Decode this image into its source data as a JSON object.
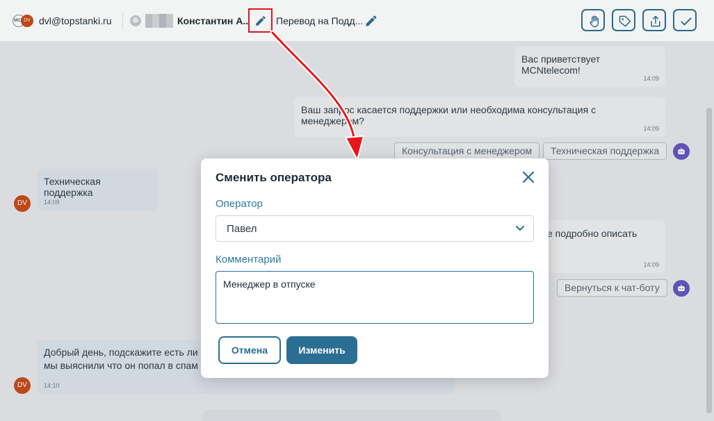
{
  "header": {
    "email": "dvl@topstanki.ru",
    "logo_left": "MCN",
    "logo_right": "DV",
    "client_name": "Константин А...",
    "transfer_label": "Перевод на Подд...",
    "icons": [
      "hand-icon",
      "tag-icon",
      "export-icon",
      "check-icon"
    ]
  },
  "chat": {
    "messages": [
      {
        "text": "Вас приветствует MCNtelecom!",
        "time": "14:09"
      },
      {
        "text": "Ваш запрос касается поддержки или необходима консультация с менеджером?",
        "time": "14:09"
      },
      {
        "text": "Техническая поддержка",
        "time": "14:09",
        "avatar": "DV"
      },
      {
        "text": "е подробно описать",
        "time": "14:09"
      },
      {
        "text_line1": "Добрый день, подскажите есть ли в",
        "text_line2": "мы выяснили что он попал в спам",
        "time": "14:10",
        "avatar": "DV"
      }
    ],
    "options_1": [
      "Консультация с менеджером",
      "Техническая поддержка"
    ],
    "options_2": [
      "Вернуться к чат-боту"
    ]
  },
  "modal": {
    "title": "Сменить оператора",
    "operator_label": "Оператор",
    "operator_value": "Павел",
    "comment_label": "Комментарий",
    "comment_value": "Менеджер в отпуске",
    "cancel_label": "Отмена",
    "submit_label": "Изменить"
  },
  "colors": {
    "accent": "#2b6e93",
    "label": "#2e7aa0",
    "highlight": "#e8161a",
    "avatar": "#c64b16",
    "bot": "#6554c0"
  }
}
